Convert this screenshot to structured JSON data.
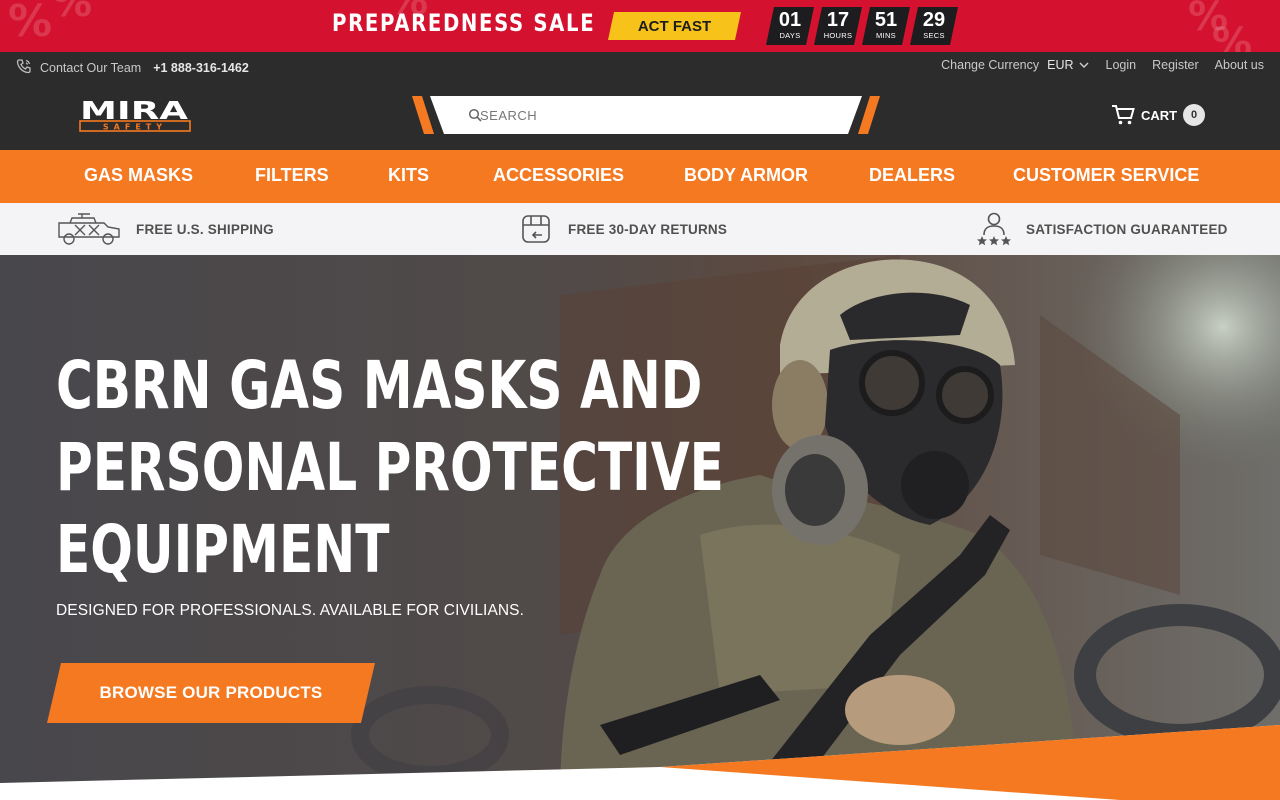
{
  "promo": {
    "title": "PREPAREDNESS SALE",
    "cta_label": "ACT FAST",
    "countdown": [
      {
        "value": "01",
        "unit": "DAYS"
      },
      {
        "value": "17",
        "unit": "HOURS"
      },
      {
        "value": "51",
        "unit": "MINS"
      },
      {
        "value": "29",
        "unit": "SECS"
      }
    ],
    "bg_color": "#d4112e",
    "cta_color": "#f7c21a"
  },
  "utility": {
    "contact_label": "Contact Our Team",
    "phone": "+1 888-316-1462",
    "change_currency_label": "Change Currency",
    "currency": "EUR",
    "login": "Login",
    "register": "Register",
    "about": "About us"
  },
  "header": {
    "logo_text": "MIRA",
    "logo_subtext": "SAFETY",
    "search_placeholder": "SEARCH",
    "cart_label": "CART",
    "cart_count": "0"
  },
  "nav": {
    "items": [
      {
        "label": "GAS MASKS"
      },
      {
        "label": "FILTERS"
      },
      {
        "label": "KITS"
      },
      {
        "label": "ACCESSORIES"
      },
      {
        "label": "BODY ARMOR"
      },
      {
        "label": "DEALERS"
      },
      {
        "label": "CUSTOMER SERVICE"
      }
    ],
    "bg_color": "#f47920"
  },
  "benefits": [
    {
      "label": "FREE U.S. SHIPPING",
      "icon": "humvee-icon"
    },
    {
      "label": "FREE 30-DAY RETURNS",
      "icon": "return-box-icon"
    },
    {
      "label": "SATISFACTION GUARANTEED",
      "icon": "user-stars-icon"
    }
  ],
  "hero": {
    "title_lines": [
      "CBRN GAS MASKS AND",
      "PERSONAL PROTECTIVE",
      "EQUIPMENT"
    ],
    "subtitle": "DESIGNED FOR PROFESSIONALS. AVAILABLE FOR CIVILIANS.",
    "cta_label": "BROWSE OUR PRODUCTS",
    "accent_color": "#f47920"
  }
}
